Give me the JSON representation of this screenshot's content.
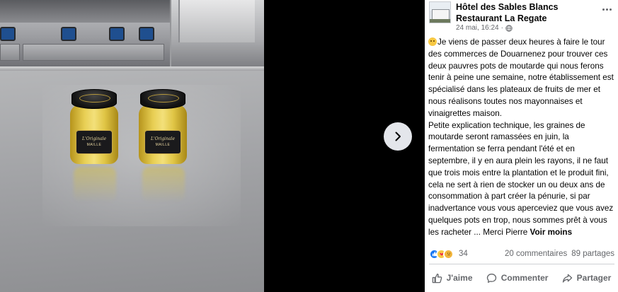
{
  "post": {
    "page_name": "Hôtel des Sables Blancs Restaurant La Regate",
    "timestamp": "24 mai, 16:24",
    "meta_separator": "·",
    "text_paragraphs": [
      "Je viens de passer deux heures à faire le tour des commerces de Douarnenez pour trouver ces deux pauvres pots de moutarde qui nous ferons tenir à peine une semaine, notre établissement est spécialisé dans les plateaux de fruits de mer et nous réalisons toutes nos mayonnaises et vinaigrettes maison.",
      "Petite explication technique, les graines de moutarde seront ramassées en juin, la fermentation se ferra pendant l'été et en septembre, il y en aura plein les rayons, il ne faut que trois mois entre la plantation et le produit fini, cela ne sert à rien de stocker un ou deux ans de consommation à part créer la pénurie, si par inadvertance vous vous aperceviez que vous avez quelques pots en trop, nous sommes prêt à vous les racheter ... Merci Pierre"
    ],
    "see_less_label": "Voir moins",
    "reaction_count": "34",
    "comments": "20 commentaires",
    "shares": "89 partages",
    "actions": {
      "like": "J'aime",
      "comment": "Commenter",
      "share": "Partager"
    }
  },
  "photo": {
    "jar_label_brand": "MAILLE",
    "jar_label_product": "L'Originale"
  },
  "icons": {
    "next": "chevron-right-icon",
    "more": "more-dots-icon",
    "privacy": "globe-icon",
    "like": "thumb-up-icon",
    "comment": "comment-bubble-icon",
    "share": "share-arrow-icon"
  },
  "colors": {
    "like_blue": "#1877f2",
    "text_primary": "#050505",
    "text_secondary": "#65676b",
    "nav_button_bg": "#e4e6eb"
  }
}
